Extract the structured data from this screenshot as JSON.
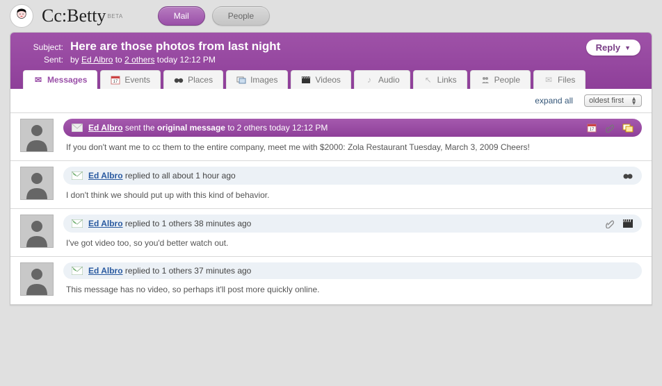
{
  "brand": {
    "name": "Cc:Betty",
    "badge": "BETA"
  },
  "nav": {
    "mail": "Mail",
    "people": "People"
  },
  "header": {
    "subjectLabel": "Subject:",
    "subject": "Here are those photos from last night",
    "sentLabel": "Sent:",
    "sentPrefix": "by ",
    "sender": "Ed Albro",
    "sentMid": " to ",
    "recipients": "2 others",
    "sentTime": " today 12:12 PM",
    "reply": "Reply"
  },
  "tabs": {
    "messages": "Messages",
    "events": "Events",
    "places": "Places",
    "images": "Images",
    "videos": "Videos",
    "audio": "Audio",
    "links": "Links",
    "people": "People",
    "files": "Files"
  },
  "controls": {
    "expand": "expand all",
    "sort": "oldest first"
  },
  "messages": [
    {
      "user": "Ed Albro",
      "actionPre": " sent the ",
      "actionBold": "original message",
      "actionPost": " to 2 others today 12:12 PM",
      "body": "If you don't want me to cc them to the entire company, meet me with $2000: Zola Restaurant Tuesday, March 3, 2009 Cheers!"
    },
    {
      "user": "Ed Albro",
      "action": " replied to all about 1 hour ago",
      "body": "I don't think we should put up with this kind of behavior."
    },
    {
      "user": "Ed Albro",
      "action": " replied to 1 others 38 minutes ago",
      "body": "I've got video too, so you'd better watch out."
    },
    {
      "user": "Ed Albro",
      "action": " replied to 1 others 37 minutes ago",
      "body": "This message has no video, so perhaps it'll post more quickly online."
    }
  ]
}
